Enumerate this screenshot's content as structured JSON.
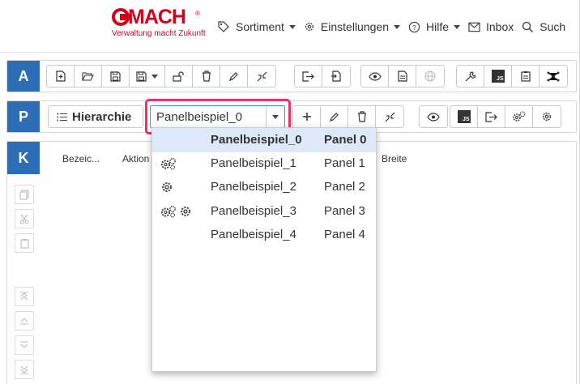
{
  "brand": {
    "logo_text": "MACH",
    "logo_reg": "®",
    "tagline": "Verwaltung macht Zukunft",
    "color": "#d4001a"
  },
  "menu": {
    "sortiment": "Sortiment",
    "einstellungen": "Einstellungen",
    "hilfe": "Hilfe",
    "inbox": "Inbox",
    "search": "Such"
  },
  "rows": {
    "a_letter": "A",
    "p_letter": "P",
    "k_letter": "K",
    "accent": "#2d6db5"
  },
  "js_label": "JS",
  "hierarchie_label": "Hierarchie",
  "panel_select": {
    "value": "Panelbeispiel_0",
    "highlight_color": "#e8336b"
  },
  "columns": {
    "bezeichnung": "Bezeic...",
    "aktion": "Aktion",
    "breite": "Breite"
  },
  "dropdown": {
    "items": [
      {
        "name": "Panelbeispiel_0",
        "panel": "Panel 0",
        "icons": ""
      },
      {
        "name": "Panelbeispiel_1",
        "panel": "Panel 1",
        "icons": "gears-icon"
      },
      {
        "name": "Panelbeispiel_2",
        "panel": "Panel 2",
        "icons": "gear-icon"
      },
      {
        "name": "Panelbeispiel_3",
        "panel": "Panel 3",
        "icons": "gears-gear-icon"
      },
      {
        "name": "Panelbeispiel_4",
        "panel": "Panel 4",
        "icons": ""
      }
    ]
  }
}
